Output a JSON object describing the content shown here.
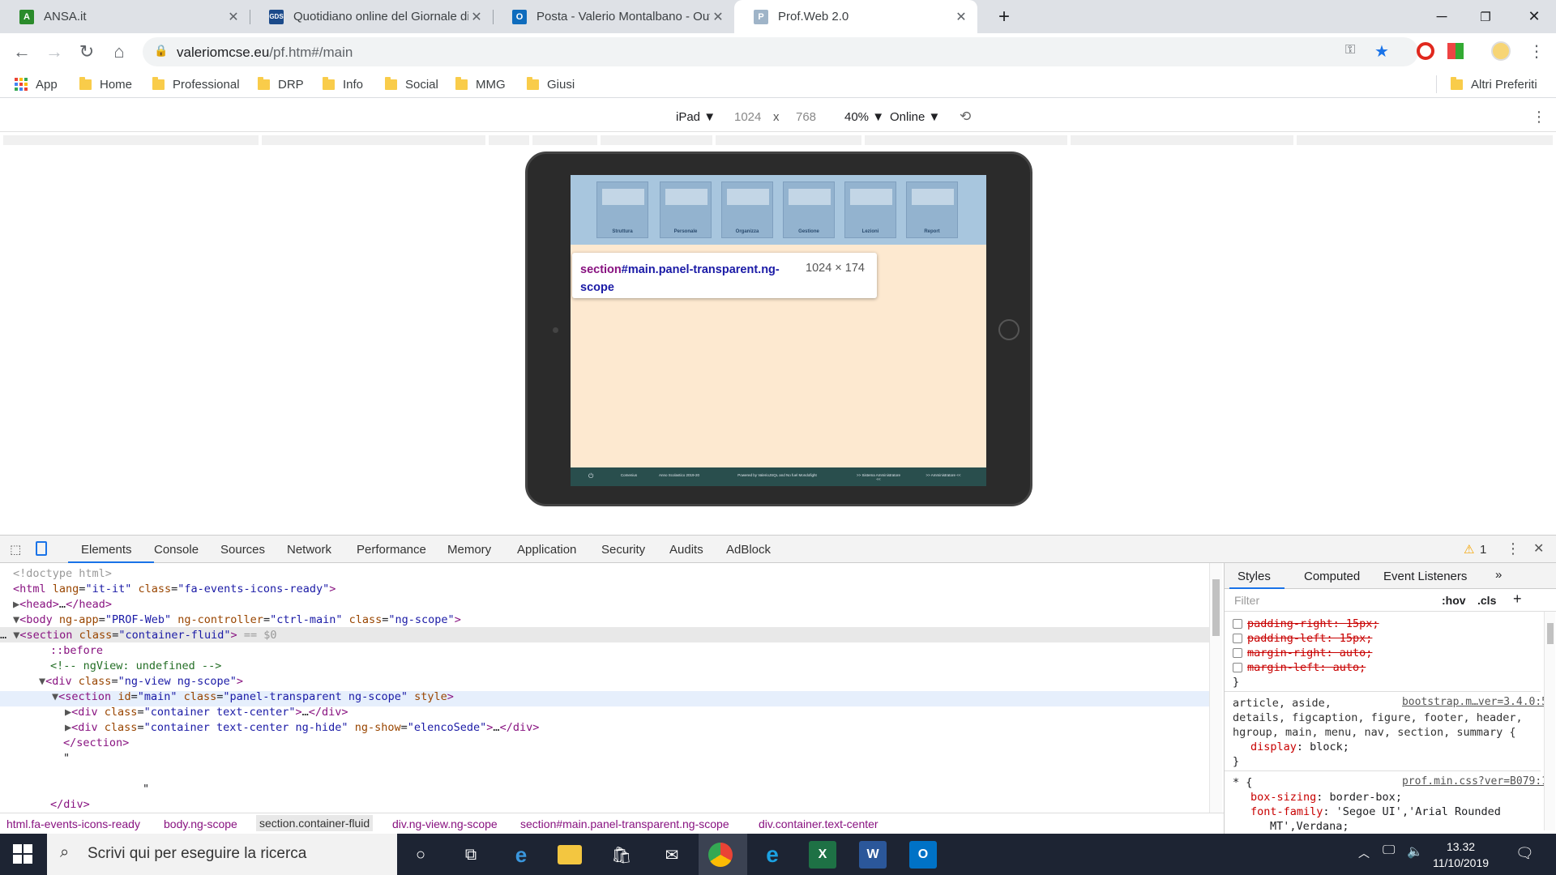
{
  "tabs": [
    {
      "title": "ANSA.it",
      "favicon": "A"
    },
    {
      "title": "Quotidiano online del Giornale di",
      "favicon": "GDS"
    },
    {
      "title": "Posta - Valerio Montalbano - Out",
      "favicon": "O"
    },
    {
      "title": "Prof.Web 2.0",
      "favicon": "P"
    }
  ],
  "url": {
    "host": "valeriomcse.eu",
    "path": "/pf.htm#/main"
  },
  "bookmarks": [
    {
      "label": "App"
    },
    {
      "label": "Home"
    },
    {
      "label": "Professional"
    },
    {
      "label": "DRP"
    },
    {
      "label": "Info"
    },
    {
      "label": "Social"
    },
    {
      "label": "MMG"
    },
    {
      "label": "Giusi"
    }
  ],
  "other_bookmarks": "Altri Preferiti",
  "device": {
    "name": "iPad ▼",
    "width": "1024",
    "times": "x",
    "height": "768",
    "zoom": "40% ▼",
    "network": "Online ▼"
  },
  "page": {
    "cards": [
      "Struttura",
      "Personale",
      "Organizza",
      "Gestione",
      "Lezioni",
      "Report"
    ],
    "footer": [
      "Comenius",
      "Anno Scolastico 2019-20",
      "Powered by ValerioJSQL and No fuel Mondofight",
      ">> Sistema Amministratore <<",
      ">> Amministratore <<"
    ]
  },
  "tooltip": {
    "selector_tag": "section",
    "selector_rest": "#main.panel-transparent.ng-scope",
    "dims": "1024 × 174"
  },
  "devtools": {
    "tabs": [
      "Elements",
      "Console",
      "Sources",
      "Network",
      "Performance",
      "Memory",
      "Application",
      "Security",
      "Audits",
      "AdBlock"
    ],
    "warnings": "1",
    "breadcrumbs": [
      "html.fa-events-icons-ready",
      "body.ng-scope",
      "section.container-fluid",
      "div.ng-view.ng-scope",
      "section#main.panel-transparent.ng-scope",
      "div.container.text-center"
    ],
    "styles_tabs": [
      "Styles",
      "Computed",
      "Event Listeners"
    ],
    "filter_placeholder": "Filter",
    "hov": ":hov",
    "cls": ".cls",
    "rule2_selector": "article, aside,\ndetails, figcaption, figure, footer, header,\nhgroup, main, menu, nav, section, summary {",
    "rule2_source": "bootstrap.m…ver=3.4.0:5",
    "rule3_source": "prof.min.css?ver=B079:1"
  },
  "taskbar": {
    "search_placeholder": "Scrivi qui per eseguire la ricerca",
    "time": "13.32",
    "date": "11/10/2019"
  }
}
